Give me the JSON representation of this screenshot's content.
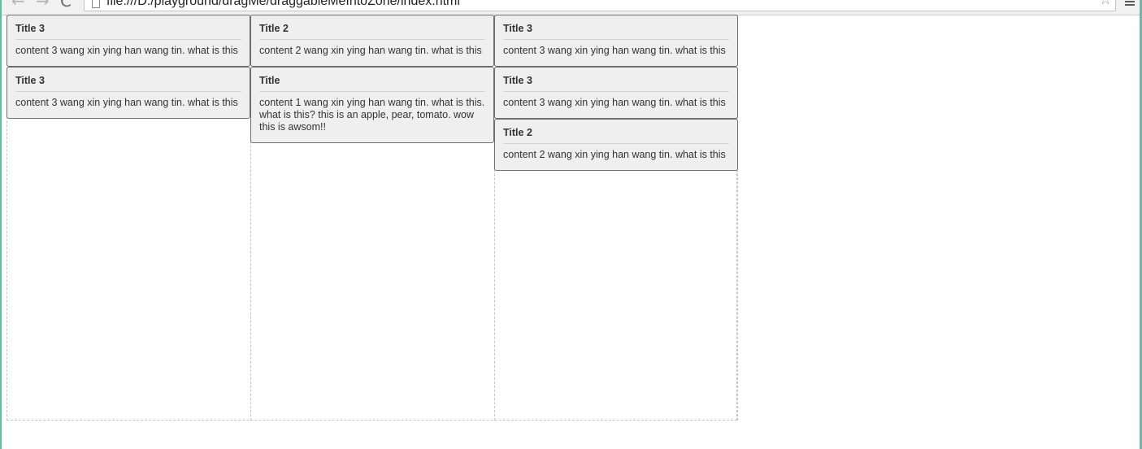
{
  "browser": {
    "url": "file:///D:/playground/dragMe/draggableMeIntoZone/index.html",
    "back_icon": "←",
    "forward_icon": "→",
    "reload_icon": "C",
    "star_icon": "☆"
  },
  "columns": [
    {
      "cards": [
        {
          "title": "Title 3",
          "content": "content 3 wang xin ying han wang tin. what is this"
        },
        {
          "title": "Title 3",
          "content": "content 3 wang xin ying han wang tin. what is this"
        }
      ]
    },
    {
      "cards": [
        {
          "title": "Title 2",
          "content": "content 2 wang xin ying han wang tin. what is this"
        },
        {
          "title": "Title",
          "content": "content 1 wang xin ying han wang tin. what is this. what is this? this is an apple, pear, tomato. wow this is awsom!!"
        }
      ]
    },
    {
      "cards": [
        {
          "title": "Title 3",
          "content": "content 3 wang xin ying han wang tin. what is this"
        },
        {
          "title": "Title 3",
          "content": "content 3 wang xin ying han wang tin. what is this"
        },
        {
          "title": "Title 2",
          "content": "content 2 wang xin ying han wang tin. what is this"
        }
      ]
    }
  ]
}
